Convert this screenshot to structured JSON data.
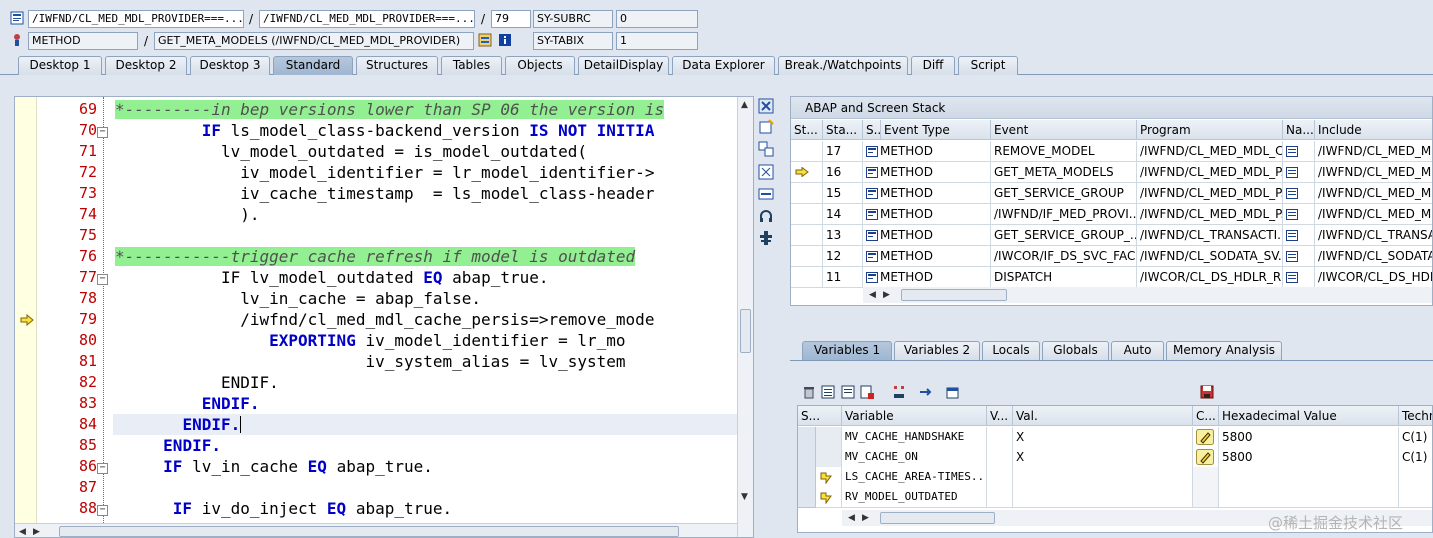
{
  "header": {
    "row1": {
      "field1": "/IWFND/CL_MED_MDL_PROVIDER===...",
      "field2": "/IWFND/CL_MED_MDL_PROVIDER===...",
      "line": "79",
      "sysvar": "SY-SUBRC",
      "sysval": "0"
    },
    "row2": {
      "event_type": "METHOD",
      "event": "GET_META_MODELS (/IWFND/CL_MED_MDL_PROVIDER)",
      "sysvar": "SY-TABIX",
      "sysval": "1"
    },
    "slash": "/"
  },
  "tabs": [
    {
      "label": "Desktop 1"
    },
    {
      "label": "Desktop 2"
    },
    {
      "label": "Desktop 3"
    },
    {
      "label": "Standard"
    },
    {
      "label": "Structures"
    },
    {
      "label": "Tables"
    },
    {
      "label": "Objects"
    },
    {
      "label": "DetailDisplay"
    },
    {
      "label": "Data Explorer"
    },
    {
      "label": "Break./Watchpoints"
    },
    {
      "label": "Diff"
    },
    {
      "label": "Script"
    }
  ],
  "code": {
    "lines": [
      {
        "num": "69"
      },
      {
        "num": "70"
      },
      {
        "num": "71"
      },
      {
        "num": "72"
      },
      {
        "num": "73"
      },
      {
        "num": "74"
      },
      {
        "num": "75"
      },
      {
        "num": "76"
      },
      {
        "num": "77"
      },
      {
        "num": "78"
      },
      {
        "num": "79"
      },
      {
        "num": "80"
      },
      {
        "num": "81"
      },
      {
        "num": "82"
      },
      {
        "num": "83"
      },
      {
        "num": "84"
      },
      {
        "num": "85"
      },
      {
        "num": "86"
      },
      {
        "num": "87"
      },
      {
        "num": "88"
      }
    ],
    "t": {
      "c69": "*---------in bep versions lower than SP 06 the version is",
      "k_if": "IF",
      "l70b": " ls_model_class-backend_version ",
      "k_isnotinitial": "IS NOT INITIA",
      "l71": "lv_model_outdated = is_model_outdated(",
      "l72": "iv_model_identifier = lr_model_identifier->",
      "l73": "iv_cache_timestamp  = ls_model_class-header",
      "l74": ").",
      "c76": "*-----------trigger cache refresh if model is outdated",
      "l77b": " lv_model_outdated ",
      "k_eq": "EQ",
      "l77d": " abap_true.",
      "l78": "lv_in_cache = abap_false.",
      "l79": "/iwfnd/cl_med_mdl_cache_persis=>remove_mode",
      "k_exporting": "EXPORTING",
      "l80b": " iv_model_identifier = lr_mo",
      "l81": "iv_system_alias = lv_system",
      "k_endif_dot": "ENDIF.",
      "l86b": " lv_in_cache ",
      "l88b": " iv_do_inject ",
      "l88d": " abap_true."
    }
  },
  "stack": {
    "title": "ABAP and Screen Stack",
    "columns": [
      "St...",
      "Sta...",
      "S...",
      "Event Type",
      "Event",
      "Program",
      "Na...",
      "Include"
    ],
    "rows": [
      {
        "level": "17",
        "etype": "METHOD",
        "event": "REMOVE_MODEL",
        "program": "/IWFND/CL_MED_MDL_C...",
        "include": "/IWFND/CL_MED_MDL"
      },
      {
        "level": "16",
        "etype": "METHOD",
        "event": "GET_META_MODELS",
        "program": "/IWFND/CL_MED_MDL_P...",
        "include": "/IWFND/CL_MED_MDL"
      },
      {
        "level": "15",
        "etype": "METHOD",
        "event": "GET_SERVICE_GROUP",
        "program": "/IWFND/CL_MED_MDL_P...",
        "include": "/IWFND/CL_MED_MDL"
      },
      {
        "level": "14",
        "etype": "METHOD",
        "event": "/IWFND/IF_MED_PROVI...",
        "program": "/IWFND/CL_MED_MDL_P...",
        "include": "/IWFND/CL_MED_MDL"
      },
      {
        "level": "13",
        "etype": "METHOD",
        "event": "GET_SERVICE_GROUP_...",
        "program": "/IWFND/CL_TRANSACTI...",
        "include": "/IWFND/CL_TRANSAC"
      },
      {
        "level": "12",
        "etype": "METHOD",
        "event": "/IWCOR/IF_DS_SVC_FAC...",
        "program": "/IWFND/CL_SODATA_SV...",
        "include": "/IWFND/CL_SODATA"
      },
      {
        "level": "11",
        "etype": "METHOD",
        "event": "DISPATCH",
        "program": "/IWCOR/CL_DS_HDLR_R...",
        "include": "/IWCOR/CL_DS_HDLR"
      }
    ]
  },
  "vartabs": [
    {
      "label": "Variables 1"
    },
    {
      "label": "Variables 2"
    },
    {
      "label": "Locals"
    },
    {
      "label": "Globals"
    },
    {
      "label": "Auto"
    },
    {
      "label": "Memory Analysis"
    }
  ],
  "vars": {
    "columns": [
      "S...",
      "Variable",
      "V...",
      "Val.",
      "C...",
      "Hexadecimal Value",
      "Techn"
    ],
    "rows": [
      {
        "name": "MV_CACHE_HANDSHAKE",
        "value": "X",
        "hex": "5800",
        "tech": "C(1)"
      },
      {
        "name": "MV_CACHE_ON",
        "value": "X",
        "hex": "5800",
        "tech": "C(1)"
      },
      {
        "name": "LS_CACHE_AREA-TIMES...",
        "value": "",
        "hex": "",
        "tech": ""
      },
      {
        "name": "RV_MODEL_OUTDATED",
        "value": "",
        "hex": "",
        "tech": ""
      }
    ]
  },
  "watermark": "@稀土掘金技术社区"
}
